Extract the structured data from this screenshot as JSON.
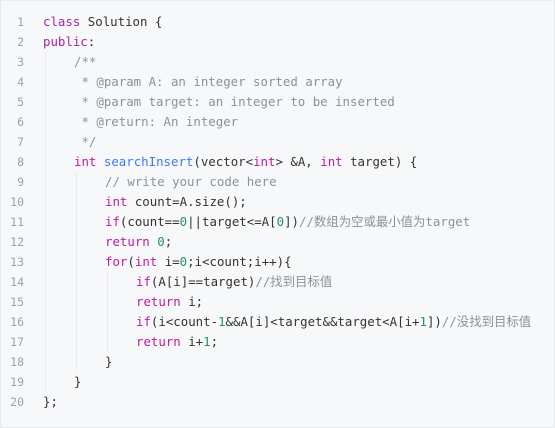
{
  "editor": {
    "line_numbers": [
      "1",
      "2",
      "3",
      "4",
      "5",
      "6",
      "7",
      "8",
      "9",
      "10",
      "11",
      "12",
      "13",
      "14",
      "15",
      "16",
      "17",
      "18",
      "19",
      "20"
    ],
    "lines": [
      {
        "indent": 0,
        "tokens": [
          {
            "c": "kw2",
            "t": "class"
          },
          {
            "c": "pl",
            "t": " Solution {"
          }
        ]
      },
      {
        "indent": 0,
        "tokens": [
          {
            "c": "kw2",
            "t": "public"
          },
          {
            "c": "pl",
            "t": ":"
          }
        ]
      },
      {
        "indent": 1,
        "tokens": [
          {
            "c": "cm",
            "t": "/**"
          }
        ]
      },
      {
        "indent": 1,
        "tokens": [
          {
            "c": "cm",
            "t": " * @param A: an integer sorted array"
          }
        ]
      },
      {
        "indent": 1,
        "tokens": [
          {
            "c": "cm",
            "t": " * @param target: an integer to be inserted"
          }
        ]
      },
      {
        "indent": 1,
        "tokens": [
          {
            "c": "cm",
            "t": " * @return: An integer"
          }
        ]
      },
      {
        "indent": 1,
        "tokens": [
          {
            "c": "cm",
            "t": " */"
          }
        ]
      },
      {
        "indent": 1,
        "tokens": [
          {
            "c": "kw",
            "t": "int"
          },
          {
            "c": "pl",
            "t": " "
          },
          {
            "c": "fn",
            "t": "searchInsert"
          },
          {
            "c": "pl",
            "t": "(vector<"
          },
          {
            "c": "kw",
            "t": "int"
          },
          {
            "c": "pl",
            "t": "> &A, "
          },
          {
            "c": "kw",
            "t": "int"
          },
          {
            "c": "pl",
            "t": " target) {"
          }
        ]
      },
      {
        "indent": 2,
        "tokens": [
          {
            "c": "cm",
            "t": "// write your code here"
          }
        ]
      },
      {
        "indent": 2,
        "tokens": [
          {
            "c": "kw",
            "t": "int"
          },
          {
            "c": "pl",
            "t": " count=A.size();"
          }
        ]
      },
      {
        "indent": 2,
        "tokens": [
          {
            "c": "kw",
            "t": "if"
          },
          {
            "c": "pl",
            "t": "(count=="
          },
          {
            "c": "num",
            "t": "0"
          },
          {
            "c": "pl",
            "t": "||target<=A["
          },
          {
            "c": "num",
            "t": "0"
          },
          {
            "c": "pl",
            "t": "])"
          },
          {
            "c": "cm",
            "t": "//数组为空或最小值为target"
          }
        ]
      },
      {
        "indent": 2,
        "tokens": [
          {
            "c": "kw",
            "t": "return"
          },
          {
            "c": "pl",
            "t": " "
          },
          {
            "c": "num",
            "t": "0"
          },
          {
            "c": "pl",
            "t": ";"
          }
        ]
      },
      {
        "indent": 2,
        "tokens": [
          {
            "c": "kw",
            "t": "for"
          },
          {
            "c": "pl",
            "t": "("
          },
          {
            "c": "kw",
            "t": "int"
          },
          {
            "c": "pl",
            "t": " i="
          },
          {
            "c": "num",
            "t": "0"
          },
          {
            "c": "pl",
            "t": ";i<count;i++){"
          }
        ]
      },
      {
        "indent": 3,
        "tokens": [
          {
            "c": "kw",
            "t": "if"
          },
          {
            "c": "pl",
            "t": "(A[i]==target)"
          },
          {
            "c": "cm",
            "t": "//找到目标值"
          }
        ]
      },
      {
        "indent": 3,
        "tokens": [
          {
            "c": "kw",
            "t": "return"
          },
          {
            "c": "pl",
            "t": " i;"
          }
        ]
      },
      {
        "indent": 3,
        "tokens": [
          {
            "c": "kw",
            "t": "if"
          },
          {
            "c": "pl",
            "t": "(i<count-"
          },
          {
            "c": "num",
            "t": "1"
          },
          {
            "c": "pl",
            "t": "&&A[i]<target&&target<A[i+"
          },
          {
            "c": "num",
            "t": "1"
          },
          {
            "c": "pl",
            "t": "])"
          },
          {
            "c": "cm",
            "t": "//没找到目标值"
          }
        ]
      },
      {
        "indent": 3,
        "tokens": [
          {
            "c": "kw",
            "t": "return"
          },
          {
            "c": "pl",
            "t": " i+"
          },
          {
            "c": "num",
            "t": "1"
          },
          {
            "c": "pl",
            "t": ";"
          }
        ]
      },
      {
        "indent": 2,
        "tokens": [
          {
            "c": "pl",
            "t": "}"
          }
        ]
      },
      {
        "indent": 1,
        "tokens": [
          {
            "c": "pl",
            "t": "}"
          }
        ]
      },
      {
        "indent": 0,
        "tokens": [
          {
            "c": "pl",
            "t": "};"
          }
        ]
      }
    ]
  }
}
